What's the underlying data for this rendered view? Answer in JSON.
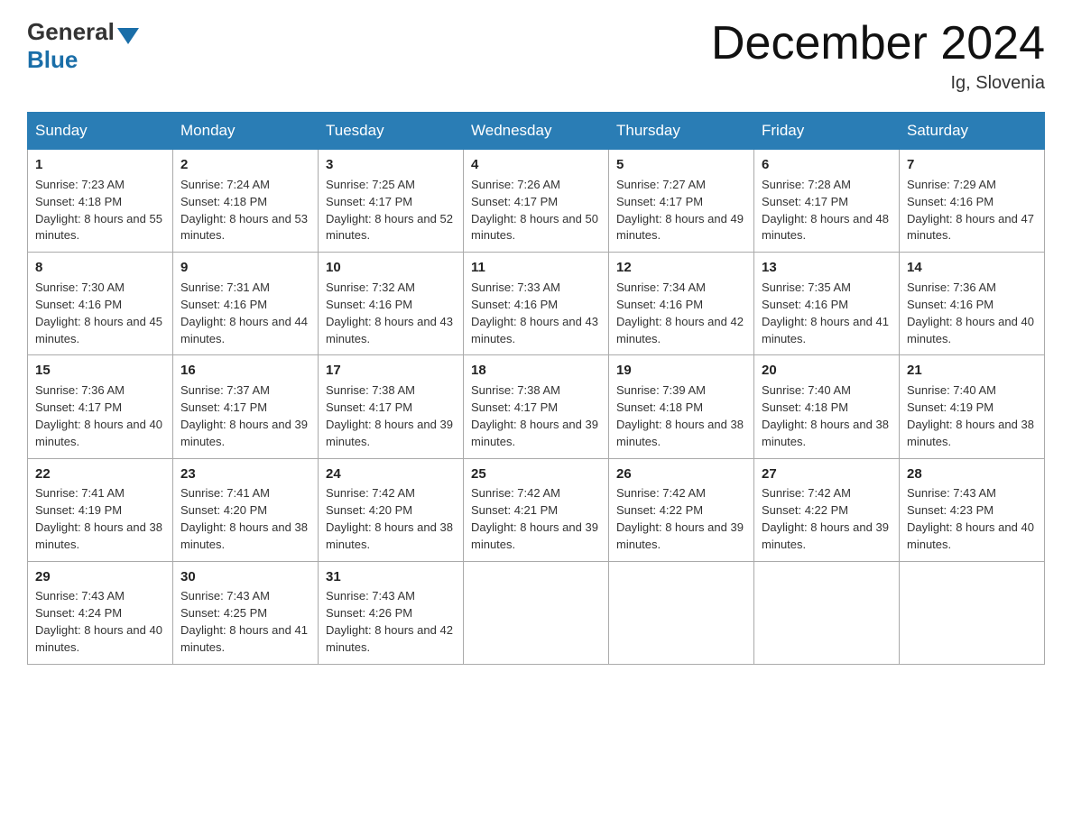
{
  "header": {
    "logo_general": "General",
    "logo_blue": "Blue",
    "month_title": "December 2024",
    "location": "Ig, Slovenia"
  },
  "days_of_week": [
    "Sunday",
    "Monday",
    "Tuesday",
    "Wednesday",
    "Thursday",
    "Friday",
    "Saturday"
  ],
  "weeks": [
    [
      {
        "day": "1",
        "sunrise": "7:23 AM",
        "sunset": "4:18 PM",
        "daylight": "8 hours and 55 minutes."
      },
      {
        "day": "2",
        "sunrise": "7:24 AM",
        "sunset": "4:18 PM",
        "daylight": "8 hours and 53 minutes."
      },
      {
        "day": "3",
        "sunrise": "7:25 AM",
        "sunset": "4:17 PM",
        "daylight": "8 hours and 52 minutes."
      },
      {
        "day": "4",
        "sunrise": "7:26 AM",
        "sunset": "4:17 PM",
        "daylight": "8 hours and 50 minutes."
      },
      {
        "day": "5",
        "sunrise": "7:27 AM",
        "sunset": "4:17 PM",
        "daylight": "8 hours and 49 minutes."
      },
      {
        "day": "6",
        "sunrise": "7:28 AM",
        "sunset": "4:17 PM",
        "daylight": "8 hours and 48 minutes."
      },
      {
        "day": "7",
        "sunrise": "7:29 AM",
        "sunset": "4:16 PM",
        "daylight": "8 hours and 47 minutes."
      }
    ],
    [
      {
        "day": "8",
        "sunrise": "7:30 AM",
        "sunset": "4:16 PM",
        "daylight": "8 hours and 45 minutes."
      },
      {
        "day": "9",
        "sunrise": "7:31 AM",
        "sunset": "4:16 PM",
        "daylight": "8 hours and 44 minutes."
      },
      {
        "day": "10",
        "sunrise": "7:32 AM",
        "sunset": "4:16 PM",
        "daylight": "8 hours and 43 minutes."
      },
      {
        "day": "11",
        "sunrise": "7:33 AM",
        "sunset": "4:16 PM",
        "daylight": "8 hours and 43 minutes."
      },
      {
        "day": "12",
        "sunrise": "7:34 AM",
        "sunset": "4:16 PM",
        "daylight": "8 hours and 42 minutes."
      },
      {
        "day": "13",
        "sunrise": "7:35 AM",
        "sunset": "4:16 PM",
        "daylight": "8 hours and 41 minutes."
      },
      {
        "day": "14",
        "sunrise": "7:36 AM",
        "sunset": "4:16 PM",
        "daylight": "8 hours and 40 minutes."
      }
    ],
    [
      {
        "day": "15",
        "sunrise": "7:36 AM",
        "sunset": "4:17 PM",
        "daylight": "8 hours and 40 minutes."
      },
      {
        "day": "16",
        "sunrise": "7:37 AM",
        "sunset": "4:17 PM",
        "daylight": "8 hours and 39 minutes."
      },
      {
        "day": "17",
        "sunrise": "7:38 AM",
        "sunset": "4:17 PM",
        "daylight": "8 hours and 39 minutes."
      },
      {
        "day": "18",
        "sunrise": "7:38 AM",
        "sunset": "4:17 PM",
        "daylight": "8 hours and 39 minutes."
      },
      {
        "day": "19",
        "sunrise": "7:39 AM",
        "sunset": "4:18 PM",
        "daylight": "8 hours and 38 minutes."
      },
      {
        "day": "20",
        "sunrise": "7:40 AM",
        "sunset": "4:18 PM",
        "daylight": "8 hours and 38 minutes."
      },
      {
        "day": "21",
        "sunrise": "7:40 AM",
        "sunset": "4:19 PM",
        "daylight": "8 hours and 38 minutes."
      }
    ],
    [
      {
        "day": "22",
        "sunrise": "7:41 AM",
        "sunset": "4:19 PM",
        "daylight": "8 hours and 38 minutes."
      },
      {
        "day": "23",
        "sunrise": "7:41 AM",
        "sunset": "4:20 PM",
        "daylight": "8 hours and 38 minutes."
      },
      {
        "day": "24",
        "sunrise": "7:42 AM",
        "sunset": "4:20 PM",
        "daylight": "8 hours and 38 minutes."
      },
      {
        "day": "25",
        "sunrise": "7:42 AM",
        "sunset": "4:21 PM",
        "daylight": "8 hours and 39 minutes."
      },
      {
        "day": "26",
        "sunrise": "7:42 AM",
        "sunset": "4:22 PM",
        "daylight": "8 hours and 39 minutes."
      },
      {
        "day": "27",
        "sunrise": "7:42 AM",
        "sunset": "4:22 PM",
        "daylight": "8 hours and 39 minutes."
      },
      {
        "day": "28",
        "sunrise": "7:43 AM",
        "sunset": "4:23 PM",
        "daylight": "8 hours and 40 minutes."
      }
    ],
    [
      {
        "day": "29",
        "sunrise": "7:43 AM",
        "sunset": "4:24 PM",
        "daylight": "8 hours and 40 minutes."
      },
      {
        "day": "30",
        "sunrise": "7:43 AM",
        "sunset": "4:25 PM",
        "daylight": "8 hours and 41 minutes."
      },
      {
        "day": "31",
        "sunrise": "7:43 AM",
        "sunset": "4:26 PM",
        "daylight": "8 hours and 42 minutes."
      },
      null,
      null,
      null,
      null
    ]
  ]
}
